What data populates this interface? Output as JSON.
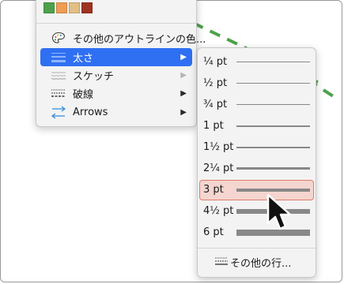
{
  "colors": {
    "accent": "#2f6ff2",
    "highlight_fill": "#f5d5cf",
    "highlight_border": "#e07b67",
    "dashed_line": "#4da14a",
    "swatches": [
      "#4da14a",
      "#ee9d52",
      "#e2bf86",
      "#9e3220"
    ]
  },
  "main_menu": {
    "items": [
      {
        "label": "その他のアウトラインの色...",
        "icon": "palette-icon",
        "has_submenu": false,
        "selected": false
      },
      {
        "label": "太さ",
        "icon": "line-weight-icon",
        "has_submenu": true,
        "selected": true
      },
      {
        "label": "スケッチ",
        "icon": "sketch-line-icon",
        "has_submenu": true,
        "selected": false,
        "arrow_dimmed": true
      },
      {
        "label": "破線",
        "icon": "dashed-line-icon",
        "has_submenu": true,
        "selected": false
      },
      {
        "label": "Arrows",
        "icon": "arrows-icon",
        "has_submenu": true,
        "selected": false
      }
    ]
  },
  "weight_submenu": {
    "items": [
      {
        "label": "¼ pt",
        "weight_pt": 0.25
      },
      {
        "label": "½ pt",
        "weight_pt": 0.5
      },
      {
        "label": "¾ pt",
        "weight_pt": 0.75
      },
      {
        "label": "1 pt",
        "weight_pt": 1
      },
      {
        "label": "1½ pt",
        "weight_pt": 1.5
      },
      {
        "label": "2¼ pt",
        "weight_pt": 2.25
      },
      {
        "label": "3 pt",
        "weight_pt": 3,
        "highlighted": true
      },
      {
        "label": "4½ pt",
        "weight_pt": 4.5
      },
      {
        "label": "6 pt",
        "weight_pt": 6
      }
    ],
    "more_label": "その他の行..."
  }
}
